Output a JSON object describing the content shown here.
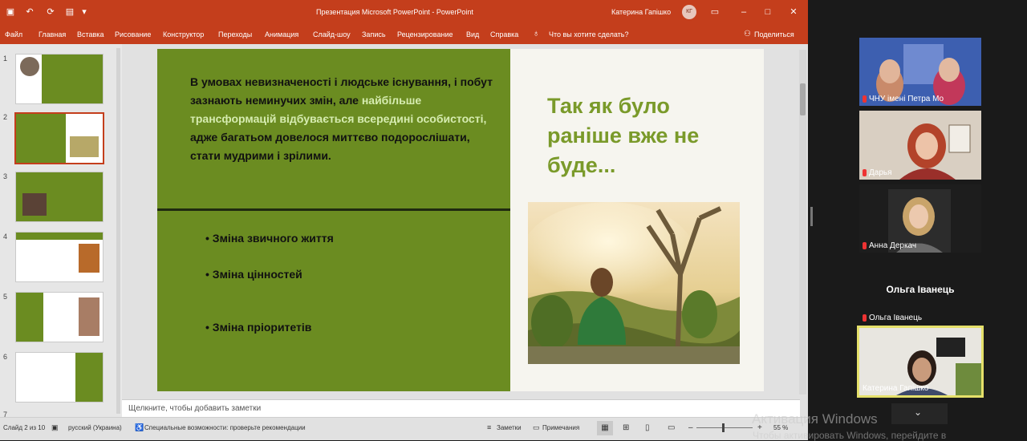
{
  "app": {
    "title": "Презентация Microsoft PowerPoint - PowerPoint",
    "user_name": "Катерина Гапішко",
    "user_initials": "КГ"
  },
  "ribbon": {
    "tabs": [
      "Файл",
      "Главная",
      "Вставка",
      "Рисование",
      "Конструктор",
      "Переходы",
      "Анимация",
      "Слайд-шоу",
      "Запись",
      "Рецензирование",
      "Вид",
      "Справка"
    ],
    "search_placeholder": "Что вы хотите сделать?",
    "share_label": "Поделиться"
  },
  "thumbnails": [
    "1",
    "2",
    "3",
    "4",
    "5",
    "6",
    "7"
  ],
  "slide": {
    "body_text_1": "В умовах невизначеності і людське існування, і побут зазнають неминучих змін, але ",
    "body_highlight": "найбільше трансформацій відбувається всередині особистості,",
    "body_text_2": " адже багатьом довелося миттєво подорослішати, стати мудрими і зрілими.",
    "bullets": [
      "Зміна звичного життя",
      "Зміна цінностей",
      "Зміна пріоритетів"
    ],
    "heading": "Так як було раніше вже не буде...",
    "colors": {
      "panel": "#6b8c21",
      "heading": "#7a9a2a",
      "highlight": "#d6ecb0"
    }
  },
  "notes_placeholder": "Щелкните, чтобы добавить заметки",
  "status": {
    "slide_counter": "Слайд 2 из 10",
    "language": "русский (Украина)",
    "accessibility": "Специальные возможности: проверьте рекомендации",
    "notes_btn": "Заметки",
    "comments_btn": "Примечания",
    "zoom": "55 %"
  },
  "participants": [
    {
      "name": "ЧНУ імені Петра Мо"
    },
    {
      "name": "Дарья"
    },
    {
      "name": "Анна Деркач"
    },
    {
      "name": "Ольга Іванець",
      "avatar_text": "Ольга Іванець"
    },
    {
      "name": "Катерина Гапішко"
    }
  ],
  "watermark": {
    "line1": "Активация Windows",
    "line2": "Чтобы активировать Windows, перейдите в"
  }
}
